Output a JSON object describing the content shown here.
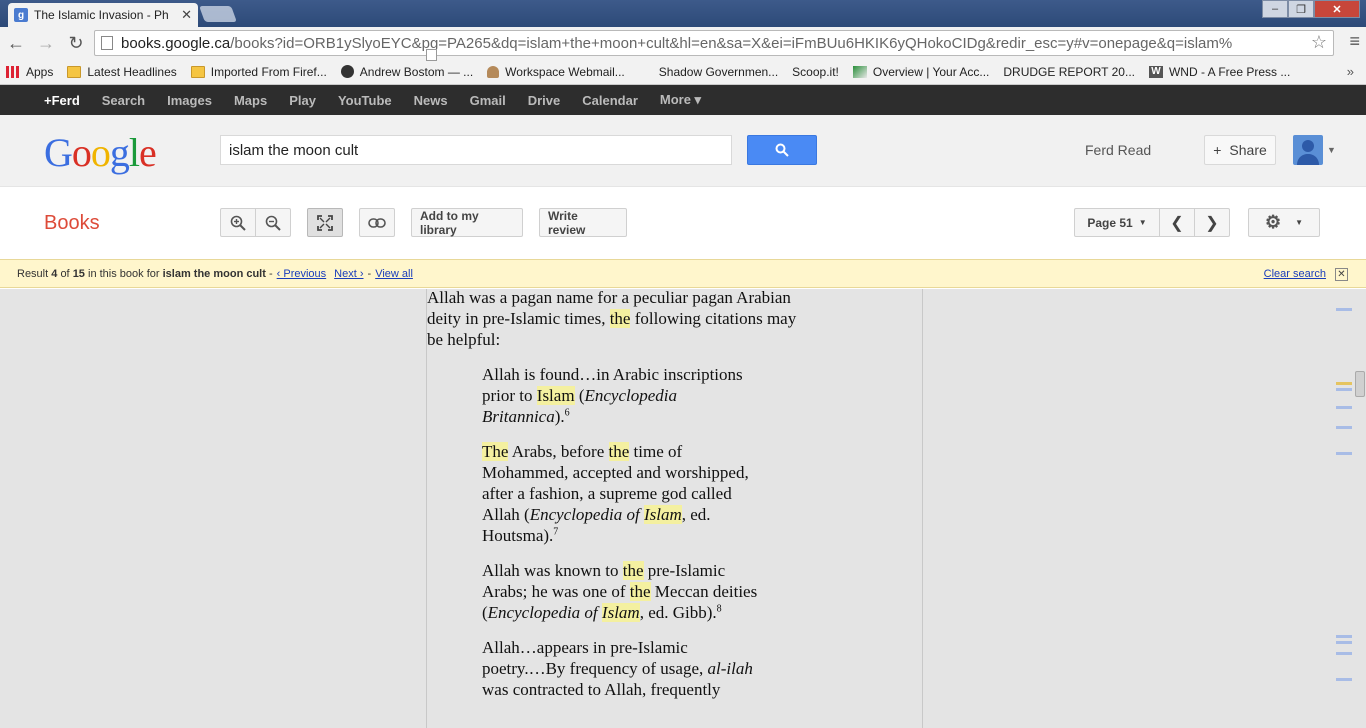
{
  "browser": {
    "tab_title": "The Islamic Invasion - Ph",
    "favicon_letter": "g",
    "url_host": "books.google.ca",
    "url_path": "/books?id=ORB1ySlyoEYC&pg=PA265&dq=islam+the+moon+cult&hl=en&sa=X&ei=iFmBUu6HKIK6yQHokoCIDg&redir_esc=y#v=onepage&q=islam%"
  },
  "bookmarks": [
    {
      "label": "Apps",
      "icon": "apps-icon"
    },
    {
      "label": "Latest Headlines",
      "icon": "folder-icon"
    },
    {
      "label": "Imported From Firef...",
      "icon": "folder-icon"
    },
    {
      "label": "Andrew Bostom — ...",
      "icon": "wordpress-icon"
    },
    {
      "label": "Workspace Webmail...",
      "icon": "webmail-icon"
    },
    {
      "label": "Shadow Governmen...",
      "icon": "page-icon"
    },
    {
      "label": "Scoop.it!",
      "icon": "page-icon"
    },
    {
      "label": "Overview | Your Acc...",
      "icon": "overview-icon"
    },
    {
      "label": "DRUDGE REPORT 20...",
      "icon": "page-icon"
    },
    {
      "label": "WND - A Free Press ...",
      "icon": "wnd-icon"
    }
  ],
  "gbar": [
    "+Ferd",
    "Search",
    "Images",
    "Maps",
    "Play",
    "YouTube",
    "News",
    "Gmail",
    "Drive",
    "Calendar",
    "More ▾"
  ],
  "header": {
    "search_query": "islam the moon cult",
    "user_name": "Ferd Read",
    "share_label": "Share"
  },
  "bookbar": {
    "title": "Books",
    "add_library": "Add to my library",
    "write_review": "Write review",
    "page_label": "Page 51"
  },
  "resultbar": {
    "result_prefix": "Result",
    "result_num": "4",
    "of": "of",
    "total": "15",
    "in_book": "in this book for",
    "query": "islam the moon cult",
    "previous": "‹ Previous",
    "next": "Next ›",
    "view_all": "View all",
    "clear": "Clear search"
  },
  "page_text": {
    "intro_1": "Allah was a pagan name for a peculiar pagan Arabian",
    "intro_2a": "deity in pre-Islamic times, ",
    "intro_2hl": "the",
    "intro_2b": " following citations may",
    "intro_3": "be helpful:",
    "q1_1": "Allah is found…in Arabic inscriptions",
    "q1_2a": "prior to ",
    "q1_2hl": "Islam",
    "q1_2b": " (",
    "q1_2i": "Encyclopedia",
    "q1_3i": "Britannica",
    "q1_3b": ").",
    "q1_fn": "6",
    "q2_1hl": "The",
    "q2_1a": " Arabs, before ",
    "q2_1hl2": "the",
    "q2_1b": " time of",
    "q2_2": "Mohammed, accepted and worshipped,",
    "q2_3": "after a fashion, a supreme god called",
    "q2_4a": "Allah (",
    "q2_4i": "Encyclopedia of ",
    "q2_4hl": "Islam",
    "q2_4b": ", ed.",
    "q2_5": "Houtsma).",
    "q2_fn": "7",
    "q3_1a": "Allah was known to ",
    "q3_1hl": "the",
    "q3_1b": " pre-Islamic",
    "q3_2a": "Arabs; he was one of ",
    "q3_2hl": "the",
    "q3_2b": " Meccan deities",
    "q3_3a": "(",
    "q3_3i": "Encyclopedia of ",
    "q3_3hl": "Islam",
    "q3_3b": ", ed. Gibb).",
    "q3_fn": "8",
    "q4_1": "Allah…appears in pre-Islamic",
    "q4_2a": "poetry.…By frequency of usage, ",
    "q4_2i": "al-ilah",
    "q4_3": "was contracted to Allah, frequently"
  }
}
